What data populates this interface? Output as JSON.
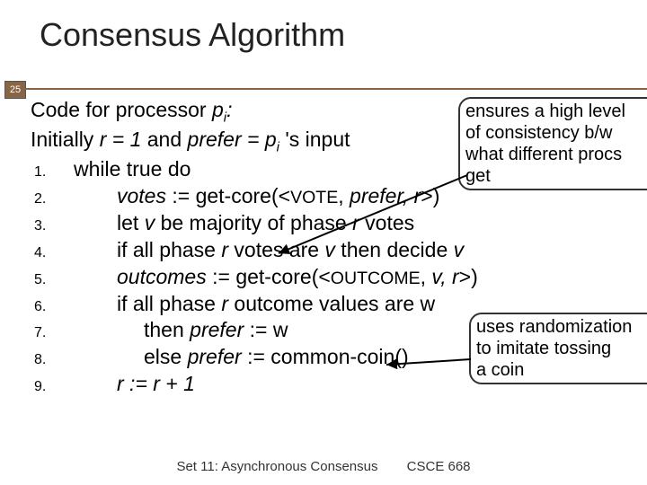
{
  "title": "Consensus Algorithm",
  "page_number": "25",
  "intro_line1_a": "Code for processor ",
  "intro_line1_b": "p",
  "intro_line1_c": "i",
  "intro_line1_d": ":",
  "intro_line2_a": "Initially ",
  "intro_line2_b": "r = 1",
  "intro_line2_c": " and ",
  "intro_line2_d": "prefer = p",
  "intro_line2_e": "i",
  "intro_line2_f": " 's input",
  "steps": [
    {
      "n": "1.",
      "type": "body1",
      "a": "while true do"
    },
    {
      "n": "2.",
      "type": "body2",
      "a": "votes",
      "b": " := get-core(<",
      "c": "VOTE",
      "d": ", ",
      "e": "prefer, r",
      "f": ">)"
    },
    {
      "n": "3.",
      "type": "body2",
      "a": "let ",
      "b": "v",
      "c": " be majority of phase ",
      "d": "r",
      "e": " votes"
    },
    {
      "n": "4.",
      "type": "body2",
      "a": "if all phase ",
      "b": "r",
      "c": " votes are ",
      "d": "v",
      "e": " then decide ",
      "f": "v"
    },
    {
      "n": "5.",
      "type": "body2",
      "a": "outcomes",
      "b": " := get-core(<",
      "c": "OUTCOME",
      "d": ", ",
      "e": "v, r",
      "f": ">)"
    },
    {
      "n": "6.",
      "type": "body2",
      "a": "if all phase ",
      "b": "r",
      "c": " outcome values are w"
    },
    {
      "n": "7.",
      "type": "body3",
      "a": "then ",
      "b": "prefer",
      "c": " := w"
    },
    {
      "n": "8.",
      "type": "body3",
      "a": "else ",
      "b": "prefer",
      "c": " := common-coin()"
    },
    {
      "n": "9.",
      "type": "body2",
      "a": "r := r + 1",
      "italic": true
    }
  ],
  "callout1": {
    "l1": "ensures a high level",
    "l2": "of consistency b/w",
    "l3": "what different procs",
    "l4": "get"
  },
  "callout2": {
    "l1": "uses randomization",
    "l2": "to imitate tossing",
    "l3": "a coin"
  },
  "footer_left": "Set 11: Asynchronous Consensus",
  "footer_right": "CSCE 668"
}
